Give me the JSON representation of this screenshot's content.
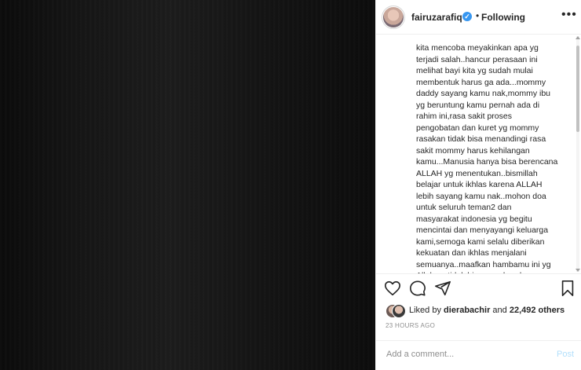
{
  "post": {
    "username": "fairuzarafiq",
    "verified_badge": "✓",
    "separator": "•",
    "follow_status": "Following",
    "more_icon": "•••",
    "caption": "kita mencoba meyakinkan apa yg\nterjadi salah..hancur perasaan ini\nmelihat bayi kita yg sudah mulai\nmembentuk harus ga ada...mommy\ndaddy sayang kamu nak,mommy ibu\nyg beruntung kamu pernah ada di\nrahim ini,rasa sakit proses\npengobatan dan kuret yg mommy\nrasakan tidak bisa menandingi rasa\nsakit mommy harus kehilangan\nkamu...Manusia hanya bisa berencana\nALLAH yg menentukan..bismillah\nbelajar untuk ikhlas karena ALLAH\nlebih sayang kamu nak..mohon doa\nuntuk seluruh teman2 dan\nmasyarakat indonesia yg begitu\nmencintai dan menyayangi keluarga\nkami,semoga kami selalu diberikan\nkekuatan dan ikhlas menjalani\nsemuanya..maafkan hambamu ini yg\nAllah yg tidak bisa membendung rasa",
    "likes": {
      "prefix": "Liked by",
      "user": "dierabachir",
      "connector": "and",
      "count": "22,492 others"
    },
    "timestamp": "23 HOURS AGO",
    "comment": {
      "placeholder": "Add a comment...",
      "value": "",
      "post_label": "Post"
    }
  },
  "colors": {
    "verified": "#3897f0",
    "text": "#262626",
    "muted": "#8e8e8e",
    "post_disabled": "#b2dffc"
  },
  "icons": [
    "heart-icon",
    "comment-icon",
    "share-icon",
    "bookmark-icon",
    "more-options-icon",
    "verified-badge-icon"
  ]
}
